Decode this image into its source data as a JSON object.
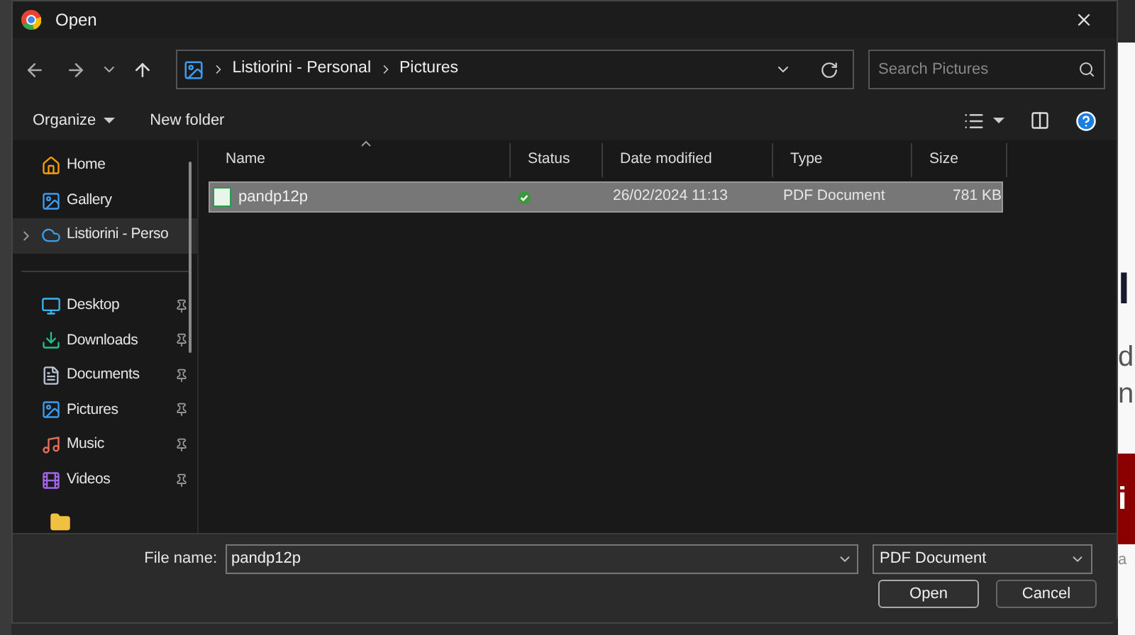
{
  "window": {
    "title": "Open"
  },
  "address_bar": {
    "crumbs": [
      "Listiorini - Personal",
      "Pictures"
    ]
  },
  "search": {
    "placeholder": "Search Pictures"
  },
  "toolbar": {
    "organize": "Organize",
    "new_folder": "New folder"
  },
  "sidebar": {
    "items": [
      {
        "label": "Home",
        "pinned": false,
        "selected": false,
        "expandable": false
      },
      {
        "label": "Gallery",
        "pinned": false,
        "selected": false,
        "expandable": false
      },
      {
        "label": "Listiorini - Perso",
        "pinned": false,
        "selected": true,
        "expandable": true
      },
      {
        "label": "Desktop",
        "pinned": true,
        "selected": false,
        "expandable": false
      },
      {
        "label": "Downloads",
        "pinned": true,
        "selected": false,
        "expandable": false
      },
      {
        "label": "Documents",
        "pinned": true,
        "selected": false,
        "expandable": false
      },
      {
        "label": "Pictures",
        "pinned": true,
        "selected": false,
        "expandable": false
      },
      {
        "label": "Music",
        "pinned": true,
        "selected": false,
        "expandable": false
      },
      {
        "label": "Videos",
        "pinned": true,
        "selected": false,
        "expandable": false
      }
    ]
  },
  "table": {
    "columns": [
      "Name",
      "Status",
      "Date modified",
      "Type",
      "Size"
    ],
    "rows": [
      {
        "name": "pandp12p",
        "synced": true,
        "date": "26/02/2024 11:13",
        "type": "PDF Document",
        "size": "781 KB",
        "selected": true
      }
    ]
  },
  "footer": {
    "file_name_label": "File name:",
    "file_name": "pandp12p",
    "file_type": "PDF Document",
    "open": "Open",
    "cancel": "Cancel"
  },
  "background_page": {
    "texts": [
      {
        "text": "l",
        "kind": "heading"
      },
      {
        "text": "d",
        "kind": "body"
      },
      {
        "text": "n",
        "kind": "body"
      },
      {
        "text": "i",
        "kind": "banner"
      },
      {
        "text": "a",
        "kind": "small"
      }
    ]
  }
}
